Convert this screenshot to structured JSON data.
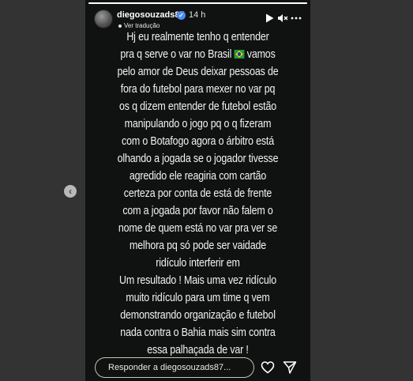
{
  "story": {
    "username": "diegosouzads87",
    "time": "14 h",
    "translate_label": "Ver tradução",
    "progress": 1.0
  },
  "caption_lines": [
    "Hj eu realmente tenho q entender",
    "pra q serve o var no Brasil",
    "pelo amor de Deus deixar pessoas de",
    "fora do futebol para mexer no var pq",
    "os q dizem entender de futebol estão",
    "manipulando o jogo pq o q fizeram",
    "com o Botafogo agora o árbitro está",
    "olhando a jogada se o jogador tivesse",
    "agredido ele reagiria com cartão",
    "certeza por conta de está de frente",
    "com a jogada por favor não falem o",
    "nome de quem está no var pra ver se",
    "melhora pq só pode ser vaidade",
    "ridículo interferir em",
    "Um resultado ! Mais uma vez ridículo",
    "muito ridículo para um time q vem",
    "demonstrando organização e futebol",
    "nada contra o Bahia mais sim contra",
    "essa palhaçada de var !"
  ],
  "caption_line2_suffix": "vamos",
  "reply": {
    "placeholder": "Responder a diegosouzads87..."
  },
  "icons": {
    "play": "play-icon",
    "mute": "speaker-muted-icon",
    "more": "more-icon",
    "heart": "heart-icon",
    "share": "send-icon",
    "prev": "chevron-left-icon",
    "flag": "brazil-flag-emoji"
  }
}
